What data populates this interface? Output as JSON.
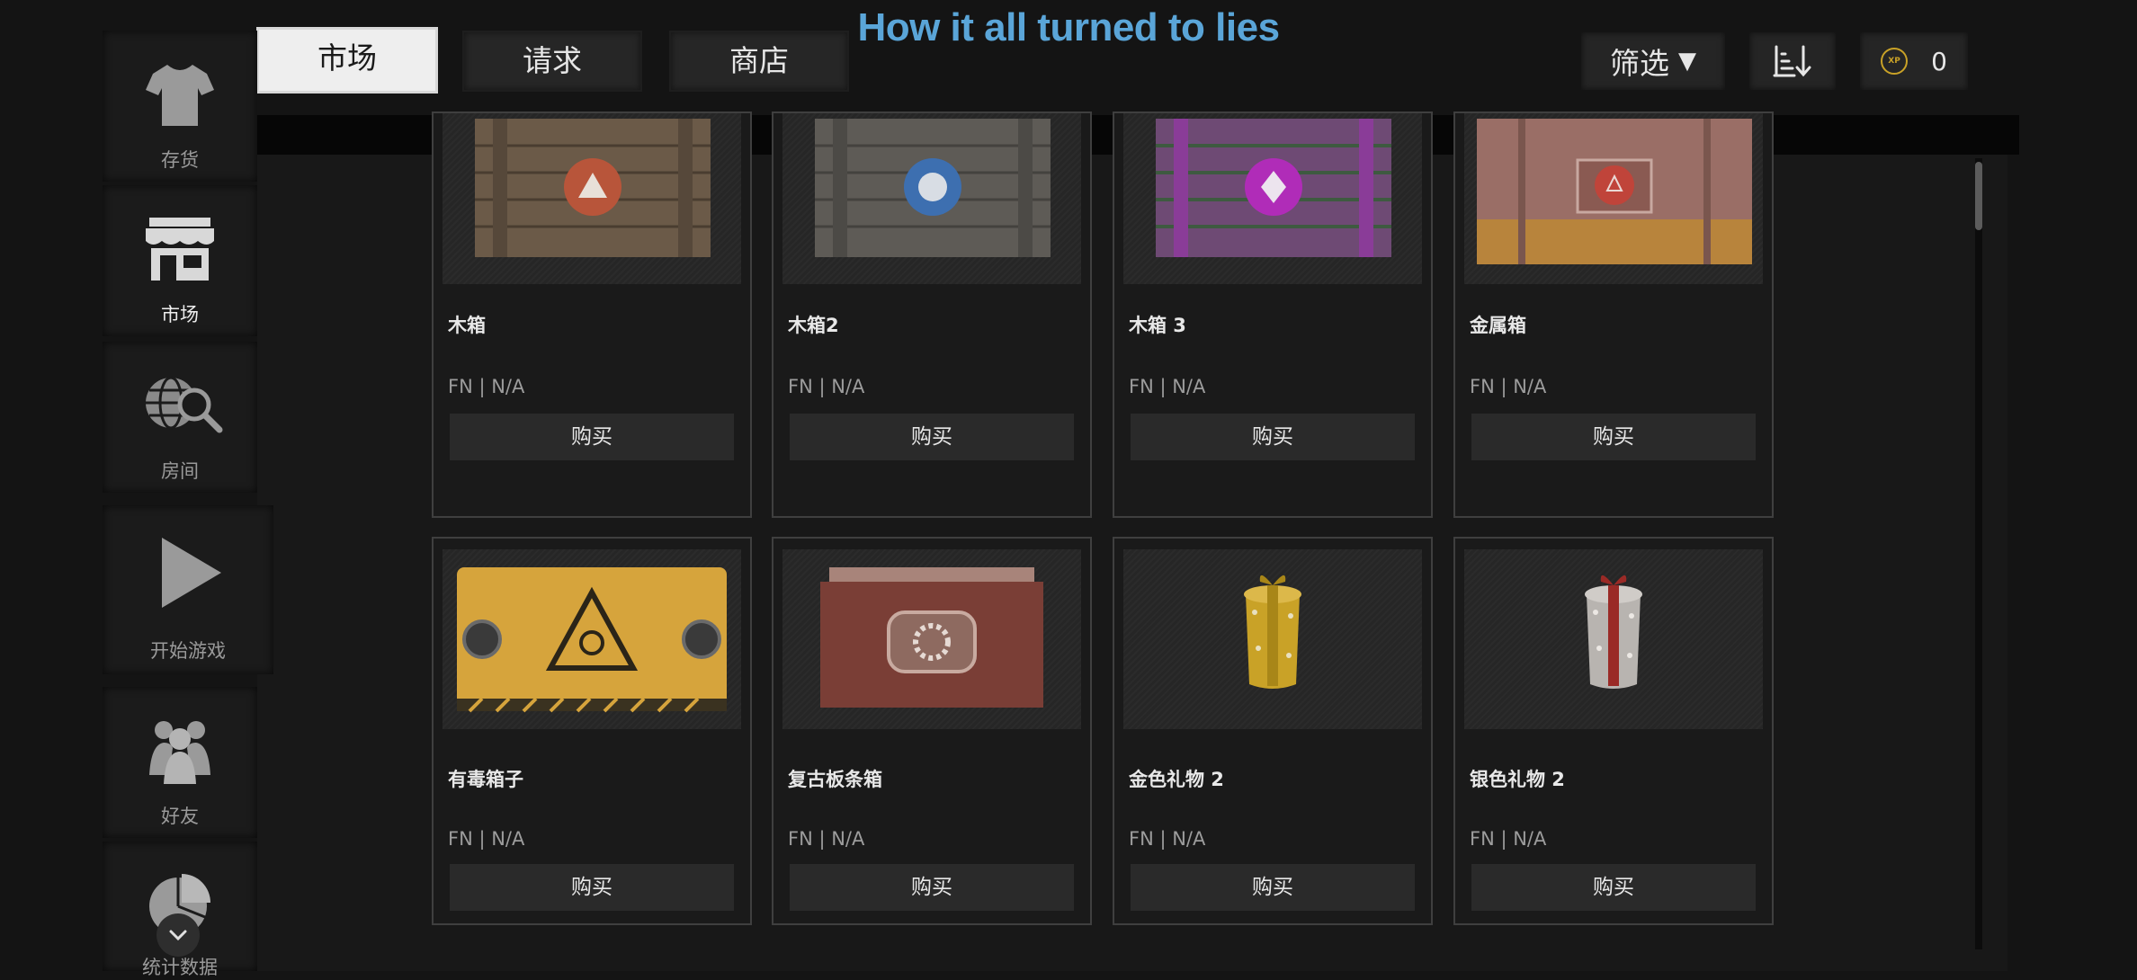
{
  "title": "How it all turned to lies",
  "tabs": [
    {
      "label": "市场",
      "active": true
    },
    {
      "label": "请求",
      "active": false
    },
    {
      "label": "商店",
      "active": false
    }
  ],
  "controls": {
    "filter_label": "筛选",
    "filter_icon": "triangle-down-icon",
    "sort_icon": "sort-descending-icon",
    "xp_icon_text": "XP",
    "xp_value": "0"
  },
  "sidebar": {
    "items": [
      {
        "label": "存货",
        "icon": "tshirt-icon"
      },
      {
        "label": "市场",
        "icon": "store-icon",
        "active": true
      },
      {
        "label": "房间",
        "icon": "globe-search-icon"
      },
      {
        "label": "开始游戏",
        "icon": "play-icon"
      },
      {
        "label": "好友",
        "icon": "friends-icon"
      },
      {
        "label": "统计数据",
        "icon": "pie-chart-icon"
      }
    ],
    "more_icon": "chevron-down-icon"
  },
  "cards": [
    {
      "name": "木箱",
      "condition": "FN | N/A",
      "buy": "购买",
      "image": "wooden-crate-icon"
    },
    {
      "name": "木箱2",
      "condition": "FN | N/A",
      "buy": "购买",
      "image": "wooden-crate-blue-icon"
    },
    {
      "name": "木箱 3",
      "condition": "FN | N/A",
      "buy": "购买",
      "image": "wooden-crate-purple-icon"
    },
    {
      "name": "金属箱",
      "condition": "FN | N/A",
      "buy": "购买",
      "image": "metal-crate-icon"
    },
    {
      "name": "有毒箱子",
      "condition": "FN | N/A",
      "buy": "购买",
      "image": "biohazard-crate-icon"
    },
    {
      "name": "复古板条箱",
      "condition": "FN | N/A",
      "buy": "购买",
      "image": "retro-crate-icon"
    },
    {
      "name": "金色礼物 2",
      "condition": "FN | N/A",
      "buy": "购买",
      "image": "gold-gift-icon"
    },
    {
      "name": "银色礼物 2",
      "condition": "FN | N/A",
      "buy": "购买",
      "image": "silver-gift-icon"
    }
  ],
  "colors": {
    "title": "#5aa5d8",
    "background": "#141414",
    "xp_coin": "#c9a227"
  }
}
